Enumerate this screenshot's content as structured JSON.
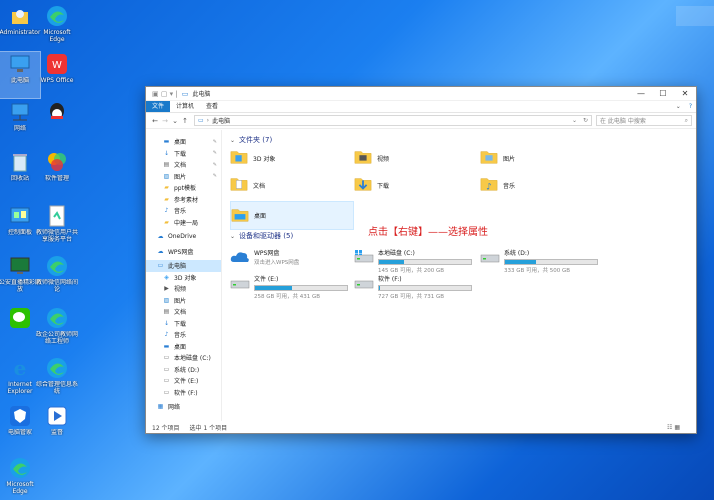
{
  "desktop": {
    "icons": [
      {
        "label": "Administrator",
        "icon": "user-folder-icon"
      },
      {
        "label": "Microsoft Edge",
        "icon": "edge-icon"
      },
      {
        "label": "此电脑",
        "icon": "computer-icon"
      },
      {
        "label": "WPS Office",
        "icon": "wps-icon"
      },
      {
        "label": "网络",
        "icon": "network-icon"
      },
      {
        "label": "",
        "icon": "qq-icon"
      },
      {
        "label": "回收站",
        "icon": "recycle-bin-icon"
      },
      {
        "label": "软件管理",
        "icon": "software-manager-icon"
      },
      {
        "label": "控制面板",
        "icon": "control-panel-icon"
      },
      {
        "label": "教师微信用户共享服务平台",
        "icon": "document-icon"
      },
      {
        "label": "公安直播精彩回放",
        "icon": "monitor-icon"
      },
      {
        "label": "教师微信网络间论",
        "icon": "edge-icon"
      },
      {
        "label": "",
        "icon": "wechat-icon"
      },
      {
        "label": "政企公司教师网络工程师",
        "icon": "edge-icon"
      },
      {
        "label": "Internet Explorer",
        "icon": "ie-icon"
      },
      {
        "label": "综合管理信息系统",
        "icon": "edge-icon"
      },
      {
        "label": "电脑管家",
        "icon": "shield-icon"
      },
      {
        "label": "监督",
        "icon": "play-icon"
      },
      {
        "label": "Microsoft Edge",
        "icon": "edge-icon"
      }
    ]
  },
  "window": {
    "title": "此电脑",
    "ribbon_tabs": [
      "文件",
      "计算机",
      "查看"
    ],
    "address_path": "此电脑",
    "search_placeholder": "在 此电脑 中搜索",
    "nav_pane": [
      {
        "label": "桌面",
        "icon": "desktop-icon",
        "pinned": true
      },
      {
        "label": "下载",
        "icon": "download-icon",
        "pinned": true
      },
      {
        "label": "文档",
        "icon": "document-icon",
        "pinned": true
      },
      {
        "label": "图片",
        "icon": "picture-icon",
        "pinned": true
      },
      {
        "label": "ppt模板",
        "icon": "folder-icon",
        "pinned": false
      },
      {
        "label": "参考素材",
        "icon": "folder-icon",
        "pinned": false
      },
      {
        "label": "音乐",
        "icon": "music-icon",
        "pinned": false
      },
      {
        "label": "中建一局",
        "icon": "folder-icon",
        "pinned": false
      },
      {
        "label": "OneDrive",
        "icon": "cloud-icon",
        "pinned": false,
        "top": true
      },
      {
        "label": "WPS网盘",
        "icon": "cloud-icon",
        "pinned": false,
        "top": true
      },
      {
        "label": "此电脑",
        "icon": "computer-icon",
        "pinned": false,
        "top": true,
        "selected": true
      },
      {
        "label": "3D 对象",
        "icon": "cube-icon",
        "pinned": false
      },
      {
        "label": "视频",
        "icon": "video-icon",
        "pinned": false
      },
      {
        "label": "图片",
        "icon": "picture-icon",
        "pinned": false
      },
      {
        "label": "文档",
        "icon": "document-icon",
        "pinned": false
      },
      {
        "label": "下载",
        "icon": "download-icon",
        "pinned": false
      },
      {
        "label": "音乐",
        "icon": "music-icon",
        "pinned": false
      },
      {
        "label": "桌面",
        "icon": "desktop-icon",
        "pinned": false
      },
      {
        "label": "本地磁盘 (C:)",
        "icon": "drive-icon",
        "pinned": false
      },
      {
        "label": "系统 (D:)",
        "icon": "drive-icon",
        "pinned": false
      },
      {
        "label": "文件 (E:)",
        "icon": "drive-icon",
        "pinned": false
      },
      {
        "label": "软件 (F:)",
        "icon": "drive-icon",
        "pinned": false
      },
      {
        "label": "网络",
        "icon": "network-icon",
        "pinned": false,
        "top": true
      }
    ],
    "folders_header": "文件夹 (7)",
    "folders": [
      {
        "label": "3D 对象",
        "icon": "cube-folder-icon"
      },
      {
        "label": "视频",
        "icon": "video-folder-icon"
      },
      {
        "label": "图片",
        "icon": "picture-folder-icon"
      },
      {
        "label": "文档",
        "icon": "document-folder-icon"
      },
      {
        "label": "下载",
        "icon": "download-folder-icon"
      },
      {
        "label": "音乐",
        "icon": "music-folder-icon"
      },
      {
        "label": "桌面",
        "icon": "desktop-folder-icon"
      }
    ],
    "annotation": "点击【右键】——选择属性",
    "drives_header": "设备和驱动器 (5)",
    "drives": [
      {
        "name": "WPS网盘",
        "sub": "双击进入WPS网盘",
        "icon": "cloud-drive-icon",
        "used_fraction": null
      },
      {
        "name": "本地磁盘 (C:)",
        "sub": "145 GB 可用，共 200 GB",
        "icon": "windows-drive-icon",
        "used_fraction": 0.275
      },
      {
        "name": "系统 (D:)",
        "sub": "333 GB 可用，共 500 GB",
        "icon": "drive-icon",
        "used_fraction": 0.334
      },
      {
        "name": "文件 (E:)",
        "sub": "258 GB 可用，共 431 GB",
        "icon": "drive-icon",
        "used_fraction": 0.4
      },
      {
        "name": "软件 (F:)",
        "sub": "727 GB 可用，共 731 GB",
        "icon": "drive-icon",
        "used_fraction": 0.006
      }
    ],
    "status_items": "12 个项目",
    "status_selected": "选中 1 个项目",
    "colors": {
      "accent": "#1979ca",
      "bar": "#26a0da",
      "annotation": "#d92020",
      "folder": "#f7c948"
    }
  }
}
